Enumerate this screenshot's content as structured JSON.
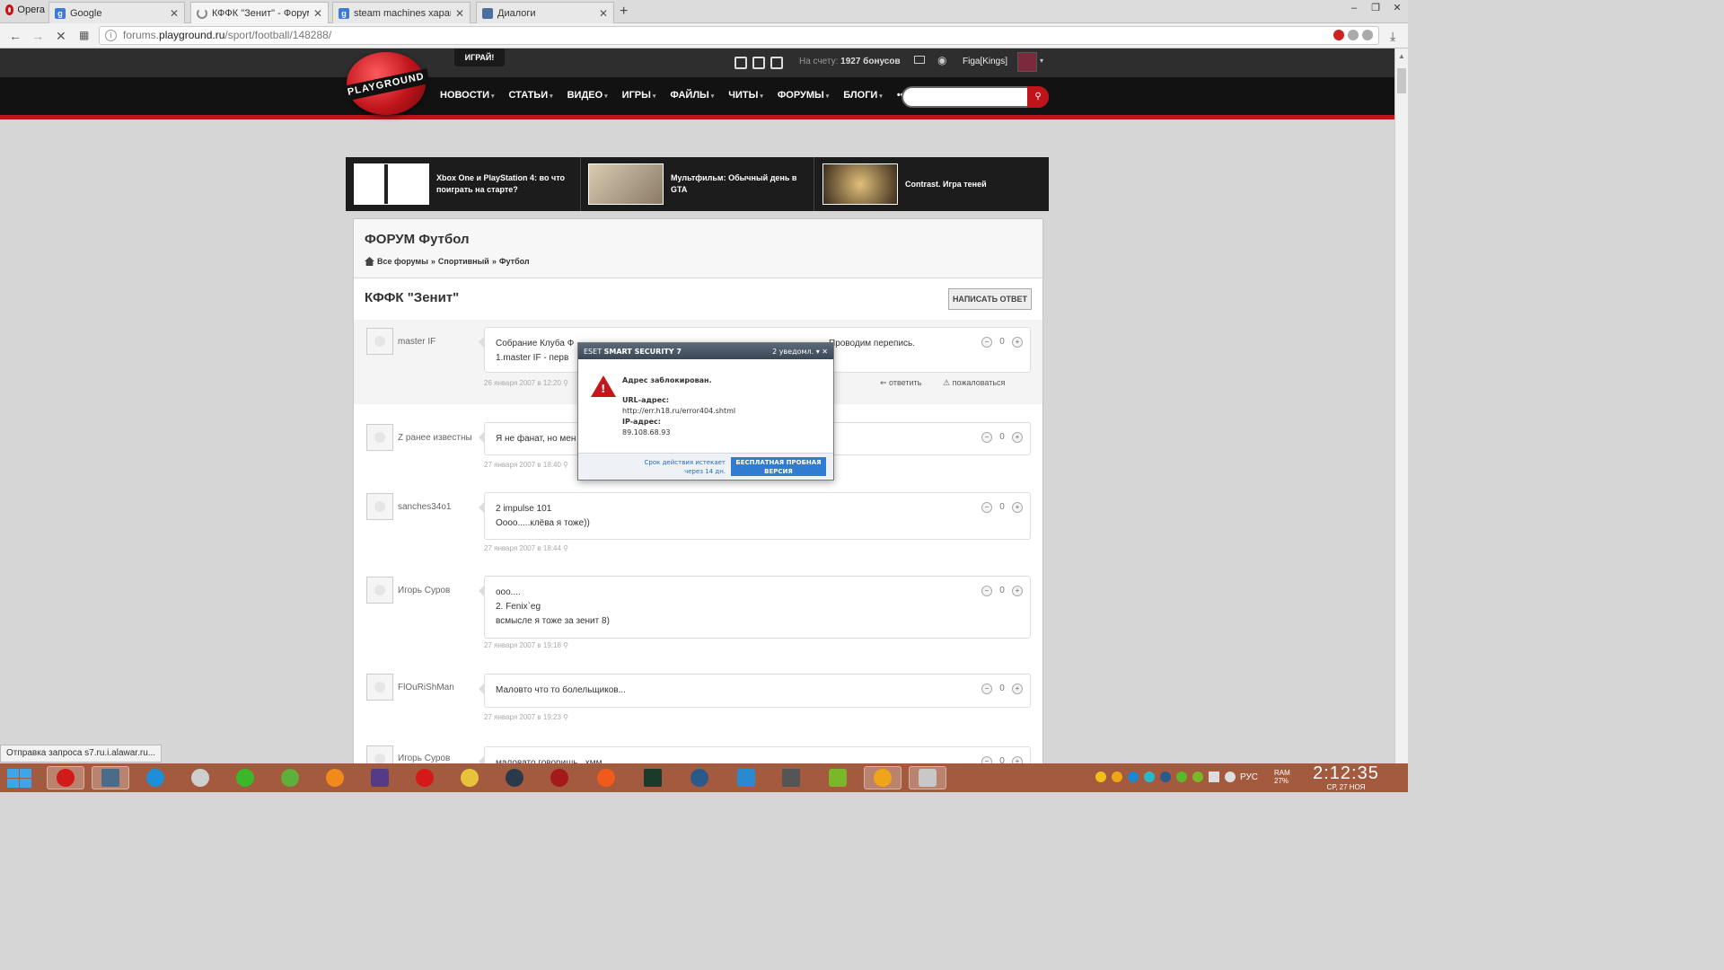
{
  "browser": {
    "app_name": "Opera",
    "tabs": [
      {
        "label": "Google",
        "favicon": "google-icon"
      },
      {
        "label": "КФФК \"Зенит\" - Форумы",
        "favicon": "loading-icon"
      },
      {
        "label": "steam machines характер",
        "favicon": "google-icon"
      },
      {
        "label": "Диалоги",
        "favicon": "dialog-icon"
      }
    ],
    "url_prefix": "forums.",
    "url_domain": "playground.ru",
    "url_path": "/sport/football/148288/",
    "status_text": "Отправка запроса s7.ru.i.alawar.ru..."
  },
  "site": {
    "logo_text": "PLAYGROUND",
    "play_button": "ИГРАЙ!",
    "bonus_prefix": "На счету:",
    "bonus_value": "1927 бонусов",
    "username": "Figa[Kings]",
    "nav": [
      "НОВОСТИ",
      "СТАТЬИ",
      "ВИДЕО",
      "ИГРЫ",
      "ФАЙЛЫ",
      "ЧИТЫ",
      "ФОРУМЫ",
      "БЛОГИ"
    ],
    "nav_more": "•••",
    "featured": [
      {
        "title": "Xbox One и PlayStation 4: во что поиграть на старте?"
      },
      {
        "title": "Мультфильм: Обычный день в GTA"
      },
      {
        "title": "Contrast. Игра теней"
      }
    ]
  },
  "forum": {
    "section_title": "ФОРУМ Футбол",
    "breadcrumb": [
      "Все форумы",
      "Спортивный",
      "Футбол"
    ],
    "breadcrumb_sep": "»",
    "thread_title": "КФФК \"Зенит\"",
    "reply_button": "НАПИСАТЬ ОТВЕТ",
    "reply_link": "ответить",
    "report_link": "пожаловаться",
    "posts": [
      {
        "author": "master IF",
        "lines": [
          "Собрание Клуба Ф",
          "1.master IF - перв"
        ],
        "line_tail": "Проводим перепись.",
        "date": "26 января 2007 в 12:20",
        "votes": "0"
      },
      {
        "author": "Z ранее известны",
        "lines": [
          "Я не фанат, но мен"
        ],
        "date": "27 января 2007 в 18:40",
        "votes": "0"
      },
      {
        "author": "sanches34o1",
        "lines": [
          "2 impulse 101",
          "Оооо.....клёва я тоже))"
        ],
        "date": "27 января 2007 в 18:44",
        "votes": "0"
      },
      {
        "author": "Игорь Суров",
        "lines": [
          "ооо....",
          "2. Fenix`eg",
          "всмысле я тоже за зенит 8)"
        ],
        "date": "27 января 2007 в 19:18",
        "votes": "0"
      },
      {
        "author": "FlOuRiShMan",
        "lines": [
          "Маловто что то болельщиков..."
        ],
        "date": "27 января 2007 в 19:23",
        "votes": "0"
      },
      {
        "author": "Игорь Суров",
        "lines": [
          "маловато говоришь...хмм.."
        ],
        "votes": "0"
      }
    ]
  },
  "eset": {
    "brand_light": "ESET",
    "brand_bold": "SMART SECURITY 7",
    "notifications": "2 уведомл.",
    "heading": "Адрес заблокирован.",
    "url_label": "URL-адрес:",
    "url_value": "http://err.h18.ru/error404.shtml",
    "ip_label": "IP-адрес:",
    "ip_value": "89.108.68.93",
    "expiry": "Срок действия истекает через 14 дн.",
    "buy_button": "БЕСПЛАТНАЯ ПРОБНАЯ ВЕРСИЯ",
    "warn_color": "#c4161c"
  },
  "taskbar": {
    "language": "РУС",
    "ram_label": "RAM",
    "ram_value": "27%",
    "time": "2:12:35",
    "date": "СР, 27 НОЯ"
  }
}
